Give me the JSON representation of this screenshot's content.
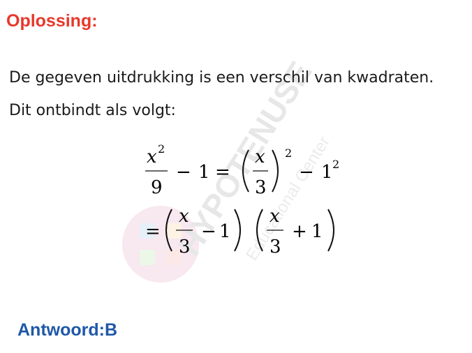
{
  "solution": {
    "heading": "Oplossing:",
    "line1": "De gegeven uitdrukking is een verschil van kwadraten.",
    "line2": "Dit ontbindt als volgt:"
  },
  "math": {
    "var": "x",
    "denominator": "3",
    "denominator_first": "9",
    "exponent": "2",
    "one": "1",
    "minus": "−",
    "plus": "+",
    "equals": "="
  },
  "watermark": {
    "brand": "HYPOTENUSE",
    "sub": "Educational Center"
  },
  "answer": {
    "text": "Antwoord:B"
  }
}
